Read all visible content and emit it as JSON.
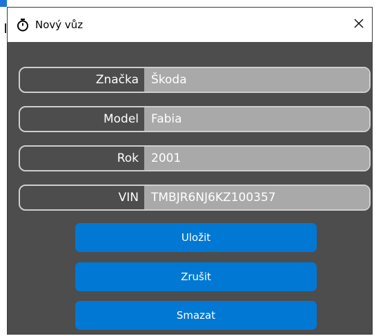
{
  "window": {
    "title": "Nový vůz",
    "title_icon": "stopwatch-icon",
    "close_icon": "close-icon"
  },
  "fields": [
    {
      "label": "Značka",
      "value": "Škoda"
    },
    {
      "label": "Model",
      "value": "Fabia"
    },
    {
      "label": "Rok",
      "value": "2001"
    },
    {
      "label": "VIN",
      "value": "TMBJR6NJ6KZ100357"
    }
  ],
  "buttons": {
    "save_label": "Uložit",
    "cancel_label": "Zrušit",
    "delete_label": "Smazat"
  },
  "colors": {
    "background": "#4d4d4d",
    "field_value_bg": "#a9a9a9",
    "button_accent": "#0078d4"
  }
}
